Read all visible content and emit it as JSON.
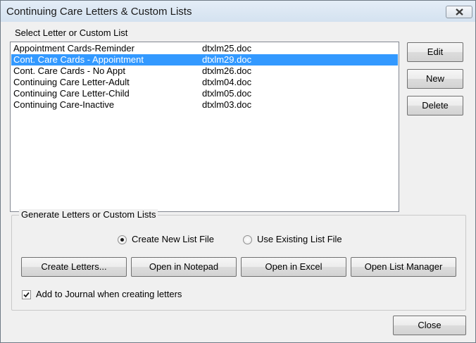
{
  "window": {
    "title": "Continuing Care Letters & Custom Lists"
  },
  "list": {
    "label": "Select Letter or Custom List",
    "items": [
      {
        "name": "Appointment Cards-Reminder",
        "file": "dtxlm25.doc",
        "selected": false
      },
      {
        "name": "Cont. Care Cards - Appointment",
        "file": "dtxlm29.doc",
        "selected": true
      },
      {
        "name": "Cont. Care Cards - No Appt",
        "file": "dtxlm26.doc",
        "selected": false
      },
      {
        "name": "Continuing Care Letter-Adult",
        "file": "dtxlm04.doc",
        "selected": false
      },
      {
        "name": "Continuing Care Letter-Child",
        "file": "dtxlm05.doc",
        "selected": false
      },
      {
        "name": "Continuing Care-Inactive",
        "file": "dtxlm03.doc",
        "selected": false
      }
    ]
  },
  "side_buttons": {
    "edit": "Edit",
    "new": "New",
    "delete": "Delete"
  },
  "generate": {
    "legend": "Generate Letters or Custom Lists",
    "radio_new": {
      "label": "Create New List File",
      "checked": true
    },
    "radio_existing": {
      "label": "Use Existing List File",
      "checked": false
    },
    "buttons": {
      "create_letters": "Create Letters...",
      "open_notepad": "Open in Notepad",
      "open_excel": "Open in Excel",
      "open_list_manager": "Open List Manager"
    },
    "journal_checkbox": {
      "label": "Add to Journal when creating letters",
      "checked": true
    }
  },
  "close_button": "Close",
  "colors": {
    "selection": "#3399ff",
    "titlebar": "#dbe6f3"
  }
}
